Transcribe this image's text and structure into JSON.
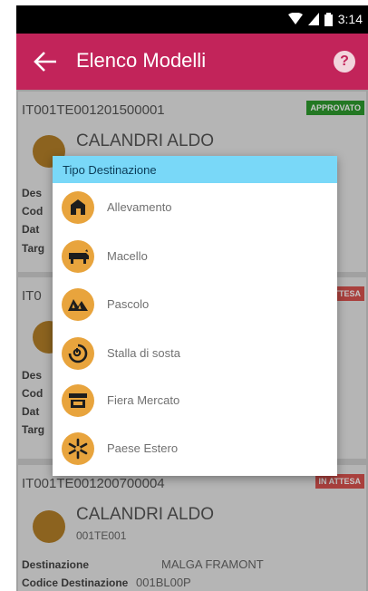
{
  "status": {
    "time": "3:14"
  },
  "appbar": {
    "title": "Elenco Modelli"
  },
  "cards": [
    {
      "id": "IT001TE001201500001",
      "badge": "APPROVATO",
      "badge_color": "#2e9a2e",
      "name": "CALANDRI ALDO",
      "code": "",
      "details": [
        {
          "label": "Des"
        },
        {
          "label": "Cod"
        },
        {
          "label": "Dat"
        },
        {
          "label": "Targ"
        }
      ]
    },
    {
      "id": "IT0",
      "badge": "ATTESA",
      "badge_color": "#d9534f",
      "name": "",
      "code": "",
      "details": [
        {
          "label": "Des"
        },
        {
          "label": "Cod"
        },
        {
          "label": "Dat"
        },
        {
          "label": "Targ"
        }
      ]
    },
    {
      "id": "IT001TE001200700004",
      "badge": "IN ATTESA",
      "badge_color": "#d9534f",
      "name": "CALANDRI ALDO",
      "code": "001TE001",
      "details": [
        {
          "label": "Destinazione",
          "value": "MALGA FRAMONT"
        },
        {
          "label": "Codice Destinazione",
          "value": "001BL00P"
        }
      ]
    }
  ],
  "dialog": {
    "title": "Tipo Destinazione",
    "options": [
      {
        "label": "Allevamento",
        "icon": "barn-icon"
      },
      {
        "label": "Macello",
        "icon": "cow-icon"
      },
      {
        "label": "Pascolo",
        "icon": "pasture-icon"
      },
      {
        "label": "Stalla di sosta",
        "icon": "clock-icon"
      },
      {
        "label": "Fiera Mercato",
        "icon": "market-stall-icon"
      },
      {
        "label": "Paese Estero",
        "icon": "star-snowflake-icon"
      }
    ]
  }
}
